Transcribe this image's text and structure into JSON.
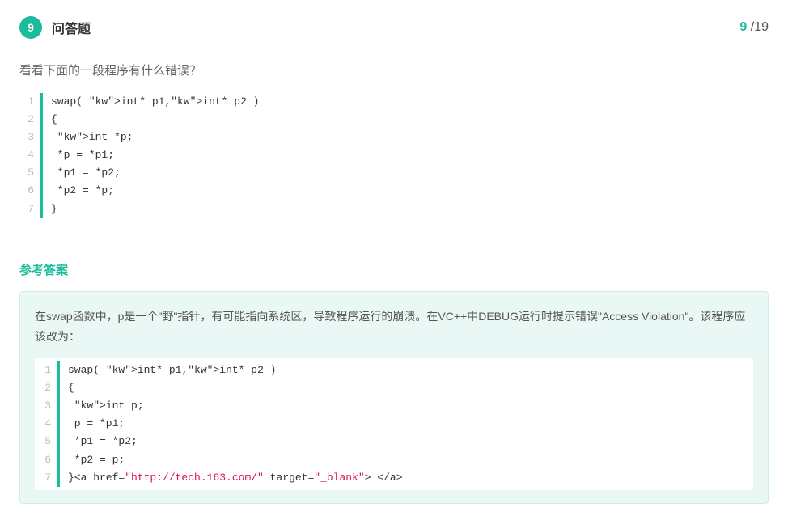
{
  "header": {
    "number": "9",
    "type": "问答题",
    "current": "9",
    "sep": " /",
    "total": "19"
  },
  "question": {
    "prompt": "看看下面的一段程序有什么错误？",
    "code_lines": [
      "swap( int* p1,int* p2 )",
      "{",
      " int *p;",
      " *p = *p1;",
      " *p1 = *p2;",
      " *p2 = *p;",
      "}"
    ]
  },
  "answer": {
    "title": "参考答案",
    "explanation": "在swap函数中，p是一个\"野\"指针，有可能指向系统区，导致程序运行的崩溃。在VC++中DEBUG运行时提示错误\"Access Violation\"。该程序应该改为：",
    "code_lines": [
      "swap( int* p1,int* p2 )",
      "{",
      " int p;",
      " p = *p1;",
      " *p1 = *p2;",
      " *p2 = p;",
      "}<a href=\"http://tech.163.com/\" target=\"_blank\"> </a>"
    ]
  }
}
